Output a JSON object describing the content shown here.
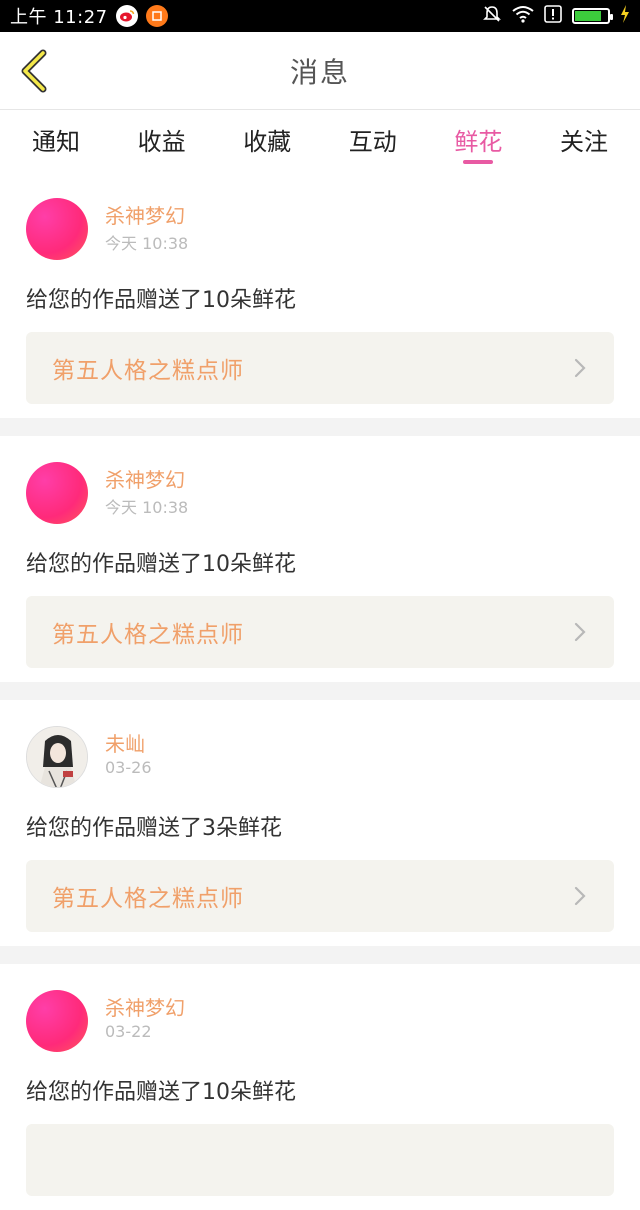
{
  "status_bar": {
    "time": "上午 11:27",
    "app_icons": [
      "weibo-icon",
      "orange-app-icon"
    ],
    "right_icons": [
      "mute-icon",
      "wifi-icon",
      "alert-icon",
      "battery-icon",
      "charging-icon"
    ]
  },
  "header": {
    "title": "消息",
    "back_icon": "chevron-left-icon"
  },
  "tabs": [
    {
      "label": "通知"
    },
    {
      "label": "收益"
    },
    {
      "label": "收藏"
    },
    {
      "label": "互动"
    },
    {
      "label": "鲜花",
      "active": true
    },
    {
      "label": "关注"
    }
  ],
  "accent_colors": {
    "active_tab": "#e85aa3",
    "username": "#f0a06a",
    "work_link_bg": "#f4f3ee"
  },
  "messages": [
    {
      "user_name": "杀神梦幻",
      "time": "今天 10:38",
      "text": "给您的作品赠送了10朵鲜花",
      "work_title": "第五人格之糕点师",
      "avatar": "gradient"
    },
    {
      "user_name": "杀神梦幻",
      "time": "今天 10:38",
      "text": "给您的作品赠送了10朵鲜花",
      "work_title": "第五人格之糕点师",
      "avatar": "gradient"
    },
    {
      "user_name": "未屾",
      "time": "03-26",
      "text": "给您的作品赠送了3朵鲜花",
      "work_title": "第五人格之糕点师",
      "avatar": "photo"
    },
    {
      "user_name": "杀神梦幻",
      "time": "03-22",
      "text": "给您的作品赠送了10朵鲜花",
      "work_title": "",
      "avatar": "gradient"
    }
  ]
}
